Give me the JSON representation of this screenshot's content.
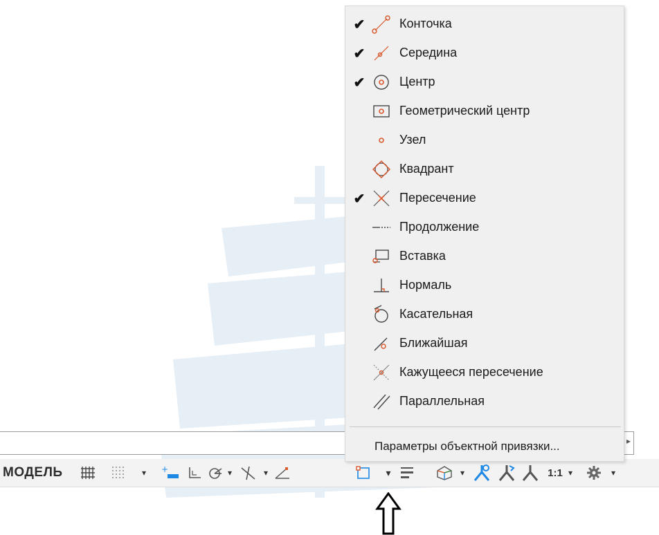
{
  "menu": {
    "items": [
      {
        "label": "Конточка",
        "checked": true,
        "icon": "endpoint-snap-icon"
      },
      {
        "label": "Середина",
        "checked": true,
        "icon": "midpoint-snap-icon"
      },
      {
        "label": "Центр",
        "checked": true,
        "icon": "center-snap-icon"
      },
      {
        "label": "Геометрический центр",
        "checked": false,
        "icon": "geometric-center-snap-icon"
      },
      {
        "label": "Узел",
        "checked": false,
        "icon": "node-snap-icon"
      },
      {
        "label": "Квадрант",
        "checked": false,
        "icon": "quadrant-snap-icon"
      },
      {
        "label": "Пересечение",
        "checked": true,
        "icon": "intersection-snap-icon"
      },
      {
        "label": "Продолжение",
        "checked": false,
        "icon": "extension-snap-icon"
      },
      {
        "label": "Вставка",
        "checked": false,
        "icon": "insertion-snap-icon"
      },
      {
        "label": "Нормаль",
        "checked": false,
        "icon": "perpendicular-snap-icon"
      },
      {
        "label": "Касательная",
        "checked": false,
        "icon": "tangent-snap-icon"
      },
      {
        "label": "Ближайшая",
        "checked": false,
        "icon": "nearest-snap-icon"
      },
      {
        "label": "Кажущееся пересечение",
        "checked": false,
        "icon": "apparent-intersection-snap-icon"
      },
      {
        "label": "Параллельная",
        "checked": false,
        "icon": "parallel-snap-icon"
      }
    ],
    "check_glyph": "✔",
    "settings_label": "Параметры объектной привязки..."
  },
  "statusbar": {
    "model_label": "МОДЕЛЬ",
    "scale_label": "1:1",
    "dropdown_glyph": "▾"
  },
  "colors": {
    "snap_accent": "#d9572b",
    "ui_blue": "#1e88e5",
    "watermark": "#e4edf5"
  }
}
